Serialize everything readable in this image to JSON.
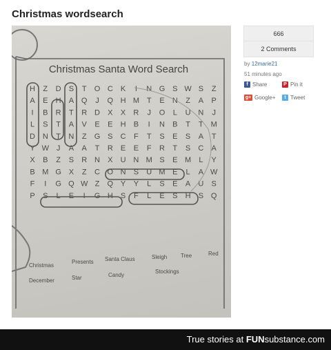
{
  "post": {
    "title": "Christmas wordsearch"
  },
  "sidebar": {
    "likes": "666",
    "comments": "2 Comments",
    "by_prefix": "by",
    "author": "12marie21",
    "time": "51 minutes ago",
    "share": {
      "facebook": "Share",
      "pinterest": "Pin it",
      "google": "Google+",
      "twitter": "Tweet"
    }
  },
  "image": {
    "heading": "Christmas Santa Word Search",
    "grid": [
      "HZDSTOCKINGSWSZ",
      "AEHAQJQHMTENZAP",
      "IBRTRDXXRJOLUNJ",
      "LSTAVEEHBINBTTM",
      "DNTNZGSCFTSESAT",
      "YWJAATREEFRTSCA",
      "XBZSRNXUNMSEMLY",
      "BMGXZCONSUMELAW",
      "FIGQWZQYYLSEAUS",
      "PSLEIGHSFLESHSQ"
    ],
    "word_list": [
      "Christmas",
      "Presents",
      "Santa Claus",
      "Sleigh",
      "Tree",
      "Red",
      "December",
      "Star",
      "Candy",
      "Stockings"
    ]
  },
  "footer": {
    "text": "True stories at",
    "brand_bold": "FUN",
    "brand_rest": "substance",
    "brand_suffix": ".com"
  },
  "colors": {
    "footer_bg": "#111111",
    "link": "#3a6ea5",
    "photo_paper": "#d2d0ca",
    "ink": "#555555"
  }
}
